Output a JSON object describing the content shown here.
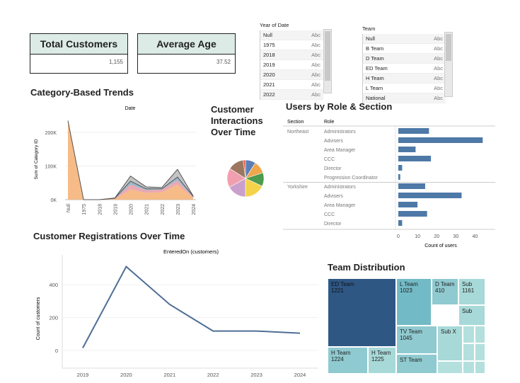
{
  "kpis": {
    "total_customers": {
      "label": "Total Customers",
      "value": "1,155"
    },
    "average_age": {
      "label": "Average Age",
      "value": "37.52"
    }
  },
  "filters": {
    "year": {
      "title": "Year of Date",
      "items": [
        {
          "label": "Null",
          "type": "Abc"
        },
        {
          "label": "1975",
          "type": "Abc"
        },
        {
          "label": "2018",
          "type": "Abc"
        },
        {
          "label": "2019",
          "type": "Abc"
        },
        {
          "label": "2020",
          "type": "Abc"
        },
        {
          "label": "2021",
          "type": "Abc"
        },
        {
          "label": "2022",
          "type": "Abc"
        }
      ]
    },
    "team": {
      "title": "Team",
      "items": [
        {
          "label": "Null",
          "type": "Abc"
        },
        {
          "label": "B Team",
          "type": "Abc"
        },
        {
          "label": "D Team",
          "type": "Abc"
        },
        {
          "label": "ED Team",
          "type": "Abc"
        },
        {
          "label": "H Team",
          "type": "Abc"
        },
        {
          "label": "L Team",
          "type": "Abc"
        },
        {
          "label": "National",
          "type": "Abc"
        }
      ]
    }
  },
  "titles": {
    "category_trends": "Category-Based Trends",
    "interactions": "Customer Interactions Over Time",
    "users_role": "Users by Role & Section",
    "registrations": "Customer Registrations Over Time",
    "team_distribution": "Team Distribution"
  },
  "chart_data": [
    {
      "type": "area",
      "title": "Category-Based Trends",
      "xlabel": "Date",
      "ylabel": "Sum of Category ID",
      "categories": [
        "Null",
        "1975",
        "2018",
        "2019",
        "2020",
        "2021",
        "2022",
        "2023",
        "2024"
      ],
      "y_ticks": [
        "0K",
        "100K",
        "200K"
      ],
      "ylim": [
        0,
        240000
      ],
      "colors": [
        "#f5b47a",
        "#e8a0a8",
        "#8fb0c8",
        "#555555"
      ],
      "series": [
        {
          "values": [
            235000,
            0,
            0,
            2000,
            30000,
            20000,
            22000,
            45000,
            5000
          ]
        },
        {
          "values": [
            0,
            0,
            0,
            1000,
            15000,
            8000,
            8000,
            12000,
            3000
          ]
        },
        {
          "values": [
            0,
            0,
            0,
            1000,
            10000,
            4000,
            2000,
            10000,
            2000
          ]
        },
        {
          "values": [
            0,
            0,
            0,
            1000,
            15000,
            6000,
            4000,
            23000,
            1000
          ]
        }
      ]
    },
    {
      "type": "pie",
      "title": "Customer Interactions Over Time",
      "slices": [
        {
          "value": 9,
          "color": "#5b7fb5"
        },
        {
          "value": 11,
          "color": "#f0a64a"
        },
        {
          "value": 12,
          "color": "#4e9a4e"
        },
        {
          "value": 18,
          "color": "#f4d24a"
        },
        {
          "value": 17,
          "color": "#c9a0cc"
        },
        {
          "value": 17,
          "color": "#f19fae"
        },
        {
          "value": 14,
          "color": "#9b7760"
        },
        {
          "value": 2,
          "color": "#e05a4a"
        }
      ]
    },
    {
      "type": "bar",
      "title": "Users by Role & Section",
      "xlabel": "Count of users",
      "header_section": "Section",
      "header_role": "Role",
      "xlim": [
        0,
        45
      ],
      "x_ticks": [
        "0",
        "10",
        "20",
        "30",
        "40"
      ],
      "color": "#4e79a7",
      "groups": [
        {
          "section": "Northeast",
          "rows": [
            {
              "role": "Administrators",
              "value": 16
            },
            {
              "role": "Advisers",
              "value": 44
            },
            {
              "role": "Area Manager",
              "value": 9
            },
            {
              "role": "CCC",
              "value": 17
            },
            {
              "role": "Director",
              "value": 2
            },
            {
              "role": "Progression Coordinator",
              "value": 1
            }
          ]
        },
        {
          "section": "Yorkshire",
          "rows": [
            {
              "role": "Administrators",
              "value": 14
            },
            {
              "role": "Advisers",
              "value": 33
            },
            {
              "role": "Area Manager",
              "value": 10
            },
            {
              "role": "CCC",
              "value": 15
            },
            {
              "role": "Director",
              "value": 2
            }
          ]
        }
      ]
    },
    {
      "type": "line",
      "title": "Customer Registrations Over Time",
      "subtitle": "EnteredOn (customers)",
      "ylabel": "Count of customers",
      "x": [
        "2019",
        "2020",
        "2021",
        "2022",
        "2023",
        "2024"
      ],
      "values": [
        15,
        510,
        280,
        118,
        118,
        105
      ],
      "y_ticks": [
        "0",
        "200",
        "400"
      ],
      "ylim": [
        0,
        560
      ],
      "color": "#4e6e96"
    },
    {
      "type": "treemap",
      "title": "Team Distribution",
      "cells": [
        {
          "label": "ED Team",
          "value": "1221",
          "color": "#2e5784"
        },
        {
          "label": "L Team",
          "value": "1023",
          "color": "#72bbc6"
        },
        {
          "label": "D Team",
          "value": "410",
          "color": "#8fcad0"
        },
        {
          "label": "Sub",
          "value": "1161",
          "color": "#a7d9d8"
        },
        {
          "label": "Sub",
          "value": "",
          "color": "#a7d9d8"
        },
        {
          "label": "TV Team",
          "value": "1045",
          "color": "#8fcad0"
        },
        {
          "label": "Sub X",
          "value": "",
          "color": "#a7d9d8"
        },
        {
          "label": "H Team",
          "value": "1224",
          "color": "#8fcad0"
        },
        {
          "label": "H Team",
          "value": "1225",
          "color": "#a7d9d8"
        },
        {
          "label": "ST Team",
          "value": "",
          "color": "#8fcad0"
        }
      ]
    }
  ]
}
